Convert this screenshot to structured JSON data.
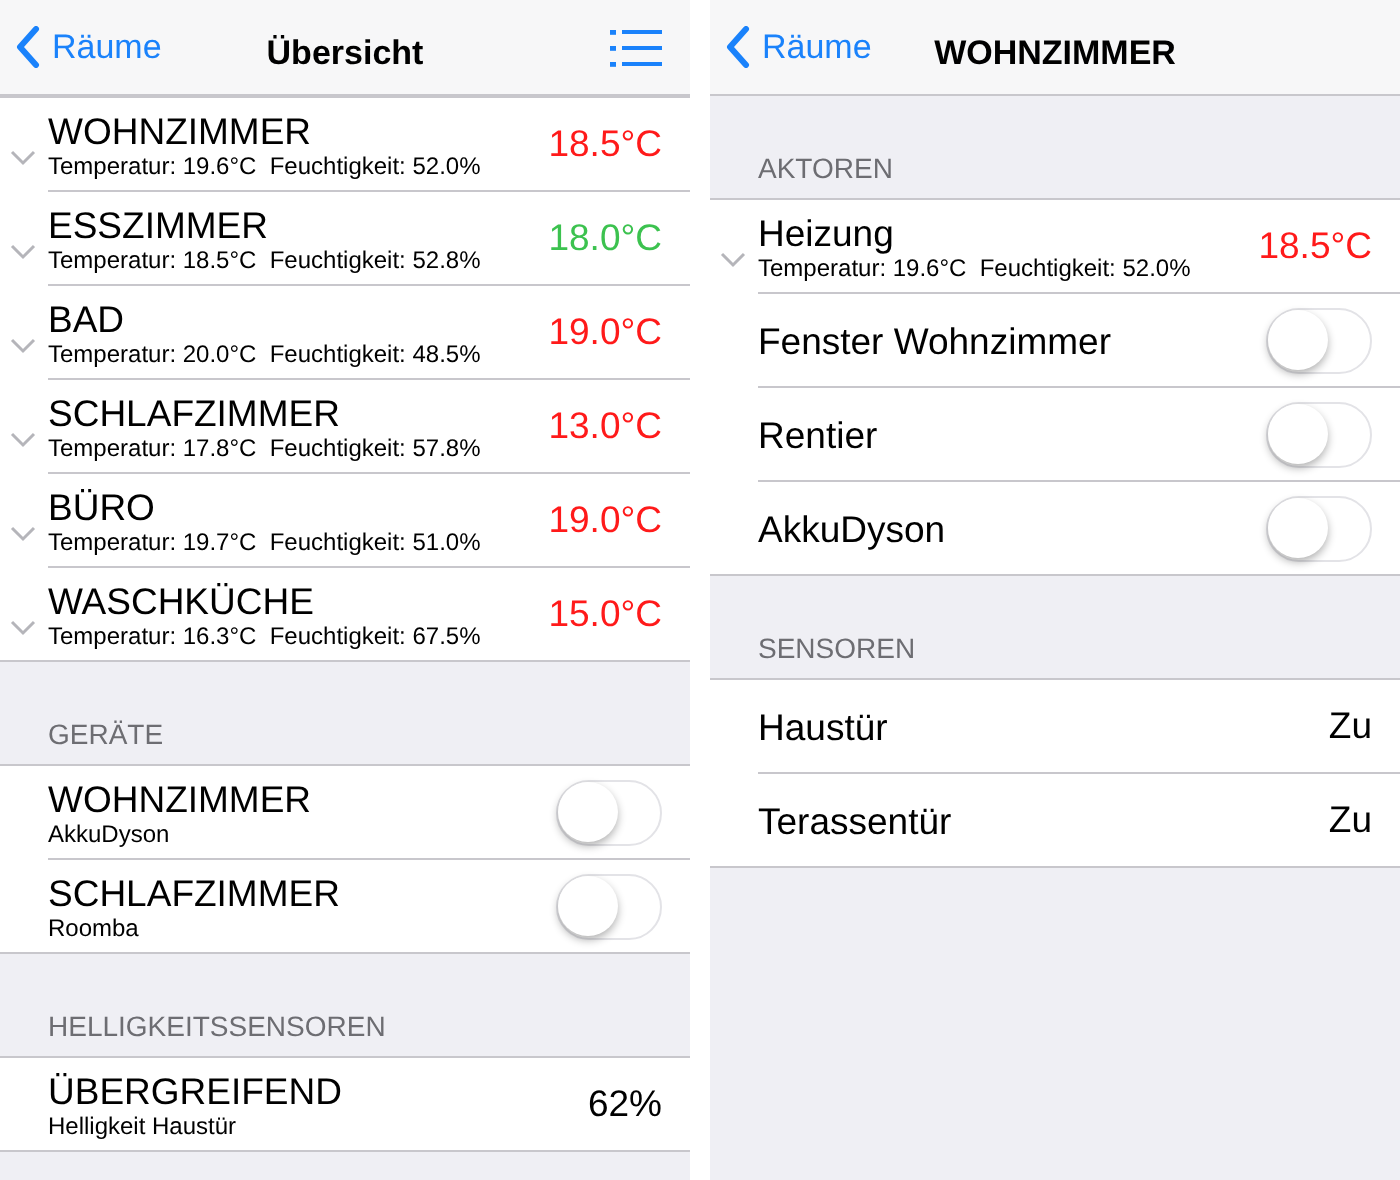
{
  "panels": [
    {
      "nav": {
        "back": "Räume",
        "title": "Übersicht",
        "menu": true
      },
      "sections": [
        {
          "items": [
            {
              "kind": "climate",
              "title": "WOHNZIMMER",
              "subtitle": "Temperatur: 19.6°C  Feuchtigkeit: 52.0%",
              "value": "18.5°C",
              "color": "#ff1a1a"
            },
            {
              "kind": "climate",
              "title": "ESSZIMMER",
              "subtitle": "Temperatur: 18.5°C  Feuchtigkeit: 52.8%",
              "value": "18.0°C",
              "color": "#3cc24f"
            },
            {
              "kind": "climate",
              "title": "BAD",
              "subtitle": "Temperatur: 20.0°C  Feuchtigkeit: 48.5%",
              "value": "19.0°C",
              "color": "#ff1a1a"
            },
            {
              "kind": "climate",
              "title": "SCHLAFZIMMER",
              "subtitle": "Temperatur: 17.8°C  Feuchtigkeit: 57.8%",
              "value": "13.0°C",
              "color": "#ff1a1a"
            },
            {
              "kind": "climate",
              "title": "BÜRO",
              "subtitle": "Temperatur: 19.7°C  Feuchtigkeit: 51.0%",
              "value": "19.0°C",
              "color": "#ff1a1a"
            },
            {
              "kind": "climate",
              "title": "WASCHKÜCHE",
              "subtitle": "Temperatur: 16.3°C  Feuchtigkeit: 67.5%",
              "value": "15.0°C",
              "color": "#ff1a1a"
            }
          ]
        },
        {
          "header": "GERÄTE",
          "items": [
            {
              "kind": "toggle",
              "title": "WOHNZIMMER",
              "subtitle": "AkkuDyson",
              "on": false
            },
            {
              "kind": "toggle",
              "title": "SCHLAFZIMMER",
              "subtitle": "Roomba",
              "on": false
            }
          ]
        },
        {
          "header": "HELLIGKEITSSENSOREN",
          "items": [
            {
              "kind": "value",
              "title": "ÜBERGREIFEND",
              "subtitle": "Helligkeit Haustür",
              "value": "62%"
            }
          ]
        }
      ]
    },
    {
      "nav": {
        "back": "Räume",
        "title": "WOHNZIMMER",
        "menu": false
      },
      "sections": [
        {
          "header": "AKTOREN",
          "items": [
            {
              "kind": "climate",
              "title": "Heizung",
              "subtitle": "Temperatur: 19.6°C  Feuchtigkeit: 52.0%",
              "value": "18.5°C",
              "color": "#ff1a1a"
            },
            {
              "kind": "toggle",
              "title": "Fenster Wohnzimmer",
              "on": false
            },
            {
              "kind": "toggle",
              "title": "Rentier",
              "on": false
            },
            {
              "kind": "toggle",
              "title": "AkkuDyson",
              "on": false
            }
          ]
        },
        {
          "header": "SENSOREN",
          "items": [
            {
              "kind": "value",
              "title": "Haustür",
              "value": "Zu"
            },
            {
              "kind": "value",
              "title": "Terassentür",
              "value": "Zu"
            }
          ]
        }
      ]
    }
  ]
}
